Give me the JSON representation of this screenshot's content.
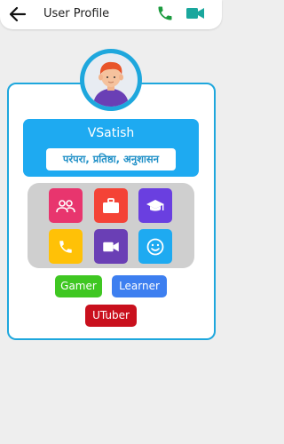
{
  "header": {
    "title": "User Profile",
    "icons": [
      "back-arrow-icon",
      "phone-icon",
      "video-camera-icon"
    ]
  },
  "profile": {
    "name": "VSatish",
    "motto": "परंपरा, प्रतिष्ठा, अनुशासन"
  },
  "actions": [
    {
      "icon": "group-icon",
      "color": "#e8356e"
    },
    {
      "icon": "briefcase-icon",
      "color": "#f44336"
    },
    {
      "icon": "graduation-cap-icon",
      "color": "#6a3fe0"
    },
    {
      "icon": "phone-icon",
      "color": "#ffc107"
    },
    {
      "icon": "video-camera-icon",
      "color": "#6a3fb5"
    },
    {
      "icon": "smiley-icon",
      "color": "#1eaaf1"
    }
  ],
  "tags": [
    {
      "label": "Gamer",
      "color": "#3fc722"
    },
    {
      "label": "Learner",
      "color": "#3d7ff0"
    },
    {
      "label": "UTuber",
      "color": "#c9101d"
    }
  ],
  "colors": {
    "accent": "#1ea7dd",
    "call_green": "#1c9b3f",
    "video_teal": "#1aa79d"
  }
}
